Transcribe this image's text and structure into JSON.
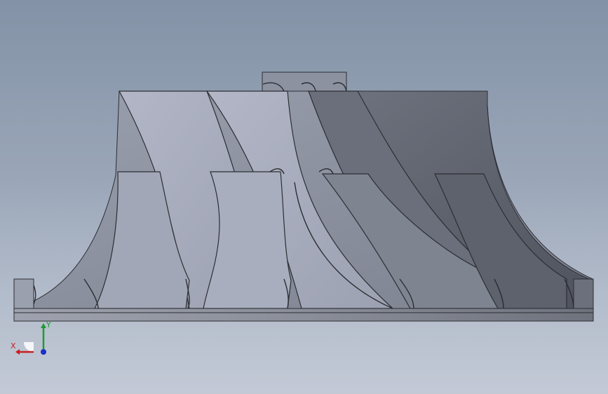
{
  "viewport": {
    "background_top": "#8392a6",
    "background_bottom": "#c3cad6",
    "model": "impeller-side-view",
    "colors": {
      "blade_light": "#a7acbd",
      "blade_mid": "#8c91a0",
      "blade_dark": "#5f6470",
      "base": "#8a8e99",
      "edge": "#2c2e33"
    }
  },
  "triad": {
    "x_label": "X",
    "y_label": "Y",
    "x_color": "#c81e1e",
    "y_color": "#1e9a32",
    "z_color": "#1e2ec8"
  }
}
